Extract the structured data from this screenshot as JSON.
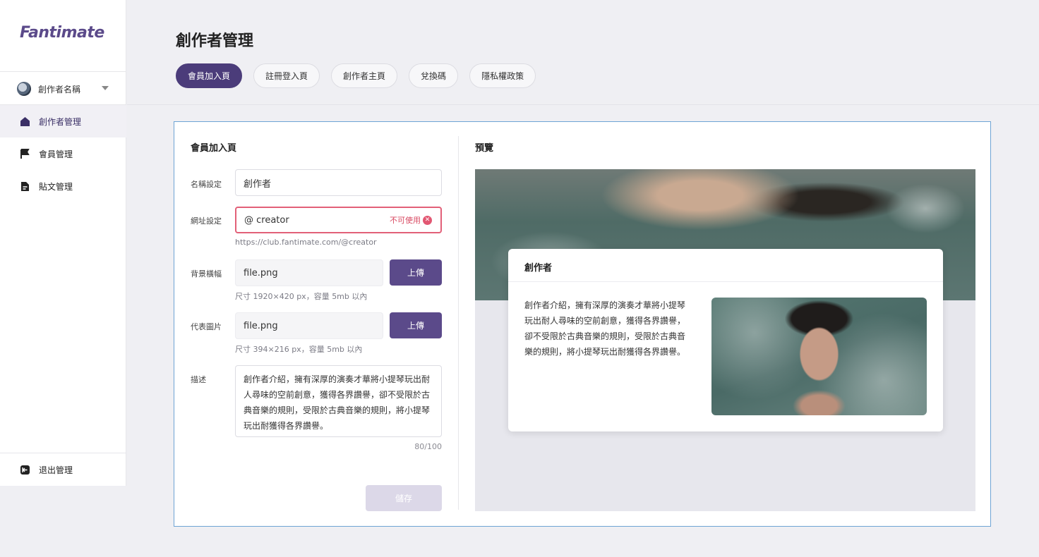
{
  "brand": {
    "logo": "Fantimate"
  },
  "sidebar": {
    "creator_name": "創作者名稱",
    "items": [
      {
        "label": "創作者管理",
        "icon": "home-icon",
        "active": true
      },
      {
        "label": "會員管理",
        "icon": "flag-icon",
        "active": false
      },
      {
        "label": "貼文管理",
        "icon": "document-icon",
        "active": false
      }
    ],
    "logout": "退出管理"
  },
  "header": {
    "title": "創作者管理",
    "tabs": [
      {
        "label": "會員加入頁",
        "active": true
      },
      {
        "label": "註冊登入頁",
        "active": false
      },
      {
        "label": "創作者主頁",
        "active": false
      },
      {
        "label": "兌換碼",
        "active": false
      },
      {
        "label": "隱私權政策",
        "active": false
      }
    ]
  },
  "form": {
    "title": "會員加入頁",
    "name_label": "名稱設定",
    "name_value": "創作者",
    "url_label": "網址設定",
    "url_value": "@ creator",
    "url_error": "不可使用",
    "url_hint": "https://club.fantimate.com/@creator",
    "banner_label": "背景橫幅",
    "banner_file": "file.png",
    "banner_hint": "尺寸 1920×420 px，容量 5mb 以內",
    "cover_label": "代表圖片",
    "cover_file": "file.png",
    "cover_hint": "尺寸 394×216 px，容量 5mb 以內",
    "upload_label": "上傳",
    "desc_label": "描述",
    "desc_value": "創作者介紹，擁有深厚的演奏才華將小提琴玩出耐人尋味的空前創意，獲得各界讚譽，卻不受限於古典音樂的規則，受限於古典音樂的規則，將小提琴玩出耐獲得各界讚譽。",
    "desc_counter": "80/100",
    "save_label": "儲存"
  },
  "preview": {
    "title": "預覽",
    "card_title": "創作者",
    "card_desc": "創作者介紹，擁有深厚的演奏才華將小提琴玩出耐人尋味的空前創意，獲得各界讚譽，卻不受限於古典音樂的規則，受限於古典音樂的規則，將小提琴玩出耐獲得各界讚譽。"
  },
  "colors": {
    "brand": "#5b4a8a",
    "tab_active": "#4b3c7a",
    "error": "#e26078",
    "card_border": "#6ea4d4"
  }
}
